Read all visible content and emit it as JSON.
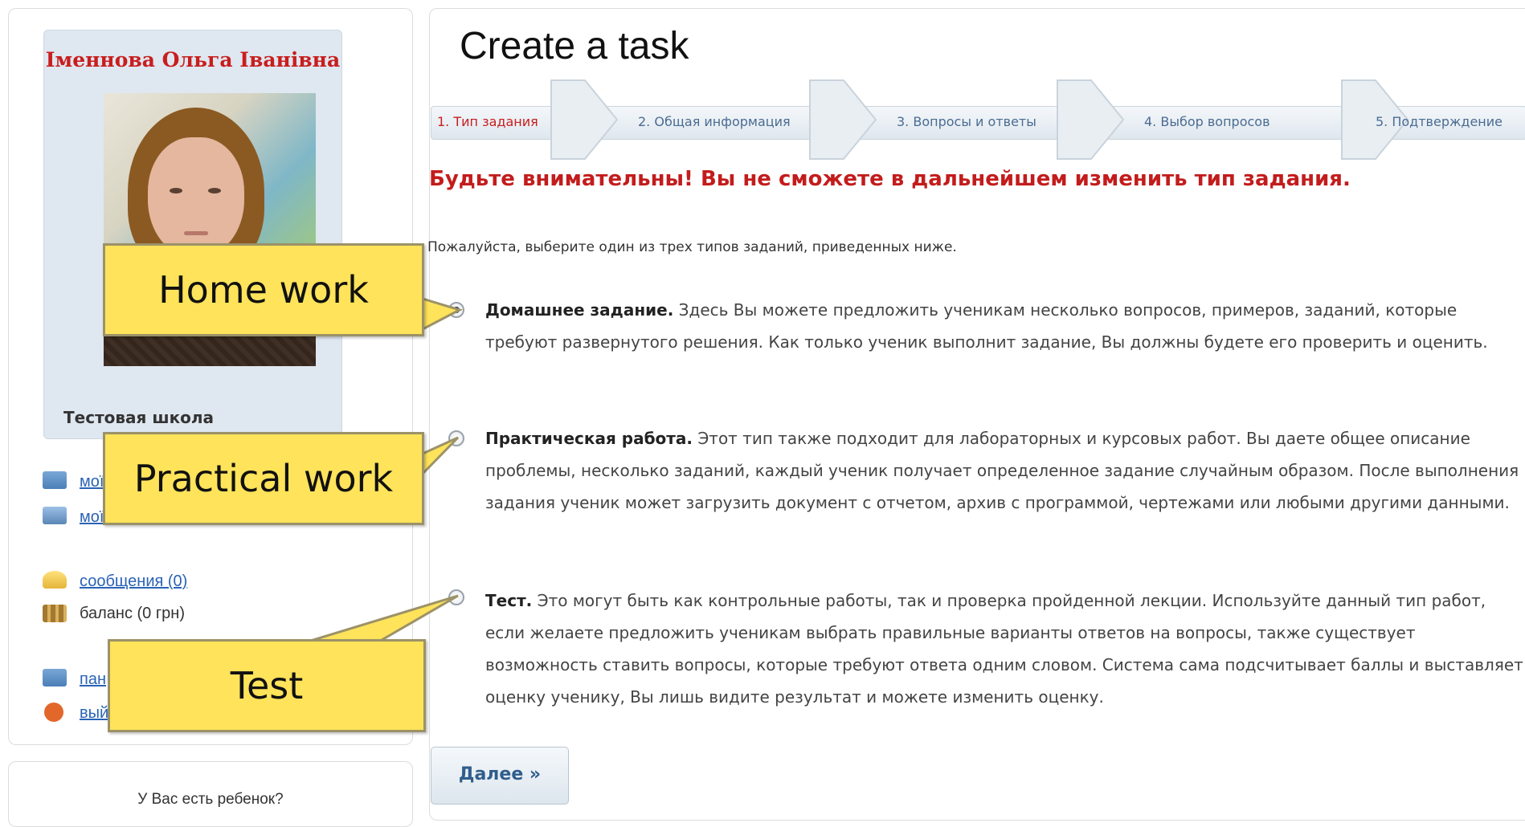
{
  "profile": {
    "name": "Іменнова Ольга Іванівна",
    "school": "Тестовая школа"
  },
  "menu": {
    "item1": "мої",
    "item2": "мої",
    "messages": "сообщения (0)",
    "balance": "баланс (0 грн)",
    "panel": "пан",
    "logout": "вый"
  },
  "sidebar_bottom": {
    "question": "У Вас есть ребенок?"
  },
  "page": {
    "title": "Create a task"
  },
  "wizard": {
    "steps": [
      "1. Тип задания",
      "2. Общая информация",
      "3. Вопросы и ответы",
      "4. Выбор вопросов",
      "5. Подтверждение"
    ],
    "active_step": 1
  },
  "warning": "Будьте внимательны! Вы не сможете в дальнейшем изменить тип задания.",
  "instruction": "Пожалуйста, выберите один из трех типов заданий, приведенных ниже.",
  "options": [
    {
      "title": "Домашнее задание.",
      "text": " Здесь Вы можете предложить ученикам несколько вопросов, примеров, заданий, которые требуют развернутого решения. Как только ученик выполнит задание, Вы должны будете его проверить и оценить.",
      "selected": true
    },
    {
      "title": "Практическая работа.",
      "text": " Этот тип также подходит для лабораторных и курсовых работ. Вы даете общее описание проблемы, несколько заданий, каждый ученик получает определенное задание случайным образом. После выполнения задания ученик может загрузить документ с отчетом, архив с программой, чертежами или любыми другими данными.",
      "selected": false
    },
    {
      "title": "Тест.",
      "text": " Это могут быть как контрольные работы, так и проверка пройденной лекции. Используйте данный тип работ, если желаете предложить ученикам выбрать правильные варианты ответов на вопросы, также существует возможность ставить вопросы, которые требуют ответа одним словом. Система сама подсчитывает баллы и выставляет оценку ученику, Вы лишь видите результат и можете изменить оценку.",
      "selected": false
    }
  ],
  "next_button": "Далее »",
  "callouts": {
    "homework": "Home work",
    "practical": "Practical work",
    "test": "Test"
  },
  "colors": {
    "accent_red": "#c81e1e",
    "link_blue": "#2a63b5",
    "callout_yellow": "#ffe35a"
  }
}
